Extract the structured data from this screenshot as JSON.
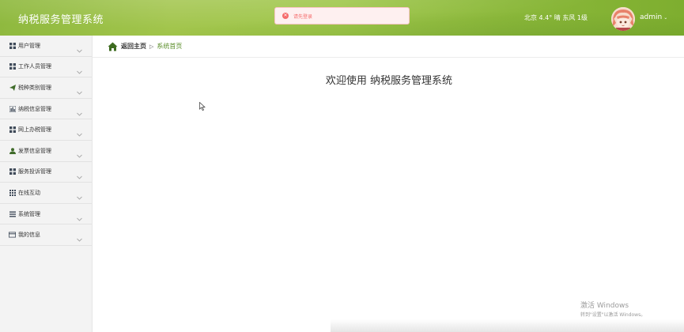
{
  "header": {
    "app_title": "纳税服务管理系统",
    "toast": "请先登录",
    "weather": "北京 4.4° 晴 东风 1级",
    "user_name": "admin"
  },
  "sidebar": {
    "items": [
      {
        "label": "用户管理",
        "icon": "grid-icon"
      },
      {
        "label": "工作人员管理",
        "icon": "grid-icon"
      },
      {
        "label": "税种类别管理",
        "icon": "paper-plane-icon"
      },
      {
        "label": "纳税信息管理",
        "icon": "bar-chart-icon"
      },
      {
        "label": "网上办税管理",
        "icon": "grid-icon"
      },
      {
        "label": "发票信息管理",
        "icon": "user-icon"
      },
      {
        "label": "服务投诉管理",
        "icon": "grid-icon"
      },
      {
        "label": "在线互动",
        "icon": "apps-icon"
      },
      {
        "label": "系统管理",
        "icon": "list-icon"
      },
      {
        "label": "我的信息",
        "icon": "id-card-icon"
      }
    ]
  },
  "breadcrumb": {
    "home": "返回主页",
    "separator": "▷",
    "current": "系统首页"
  },
  "main": {
    "welcome": "欢迎使用 纳税服务管理系统"
  },
  "watermark": {
    "title": "激活 Windows",
    "subtitle": "转到\"设置\"以激活 Windows。"
  },
  "colors": {
    "header_green": "#9ec649",
    "accent_green": "#5b8e2a",
    "error_red": "#f56c6c"
  }
}
